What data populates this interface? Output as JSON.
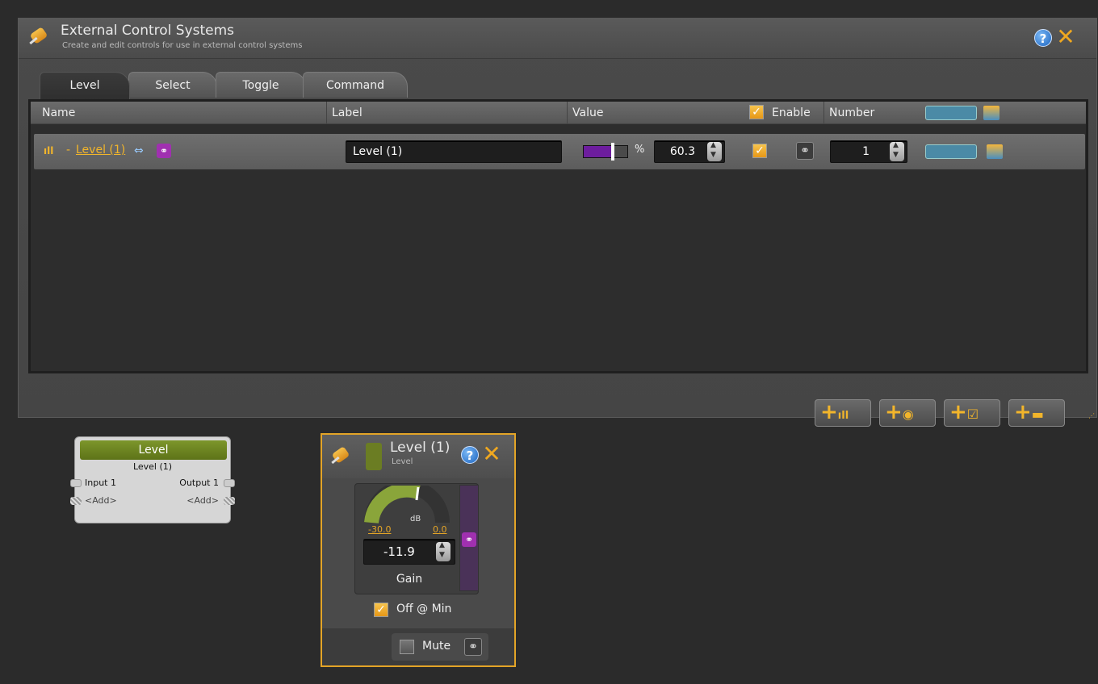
{
  "ext_panel": {
    "title": "External Control Systems",
    "subtitle": "Create and edit controls for use in external control systems",
    "tabs": [
      "Level",
      "Select",
      "Toggle",
      "Command"
    ],
    "active_tab": "Level",
    "columns": {
      "name": "Name",
      "label": "Label",
      "value": "Value",
      "enable": "Enable",
      "number": "Number"
    },
    "row": {
      "dash": "-",
      "name_link": "Level (1)",
      "label_value": "Level (1)",
      "value_unit": "%",
      "value": "60.3",
      "slider_fraction": 0.6,
      "number": "1",
      "enabled": true
    }
  },
  "level_block": {
    "title": "Level",
    "subtitle": "Level (1)",
    "input": "Input 1",
    "output": "Output 1",
    "add_left": "<Add>",
    "add_right": "<Add>"
  },
  "popup": {
    "title": "Level (1)",
    "subtitle": "Level",
    "gauge_unit": "dB",
    "min_label": "-30.0",
    "max_label": "0.0",
    "gain_value": "-11.9",
    "gain_fraction": 0.6,
    "gain_label": "Gain",
    "off_at_min": "Off @ Min",
    "off_at_min_checked": true,
    "mute": "Mute",
    "mute_checked": false
  },
  "colors": {
    "accent": "#e3a427",
    "link_orange": "#e3a427",
    "purple": "#6d1d9e",
    "green": "#7d962b"
  }
}
